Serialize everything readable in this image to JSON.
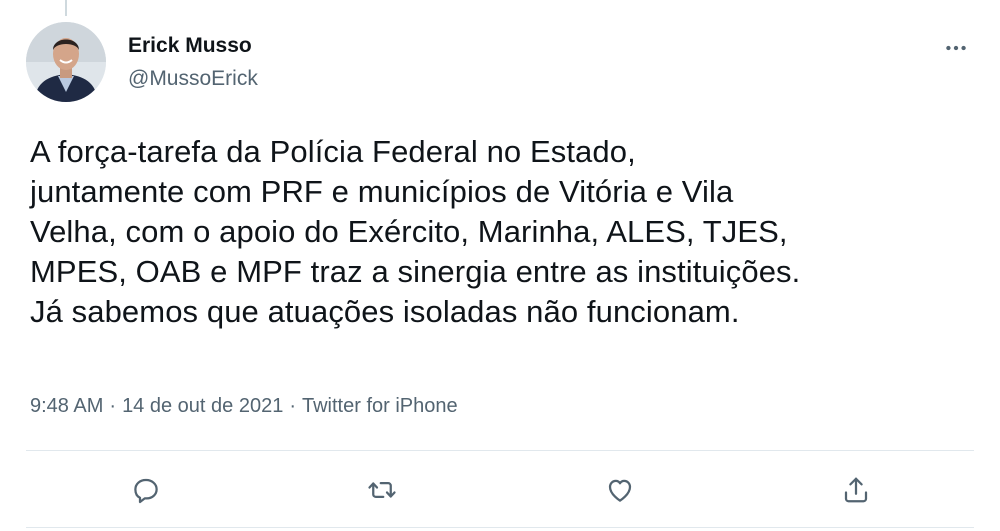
{
  "author": {
    "display_name": "Erick Musso",
    "handle": "@MussoErick"
  },
  "tweet": {
    "lines": [
      "A força-tarefa da Polícia Federal no Estado,",
      "juntamente com PRF e municípios de Vitória e Vila",
      "Velha, com o apoio do Exército, Marinha, ALES, TJES,",
      "MPES, OAB e MPF traz a sinergia entre as instituições.",
      "Já sabemos que atuações isoladas não funcionam."
    ],
    "time": "9:48 AM",
    "date": "14 de out de 2021",
    "source": "Twitter for iPhone",
    "separator": "·"
  },
  "icons": {
    "more": "more-horizontal-icon",
    "reply": "reply-icon",
    "retweet": "retweet-icon",
    "like": "heart-icon",
    "share": "share-icon"
  },
  "colors": {
    "text": "#0f1419",
    "secondary": "#536471",
    "divider": "#e1e8ed"
  }
}
